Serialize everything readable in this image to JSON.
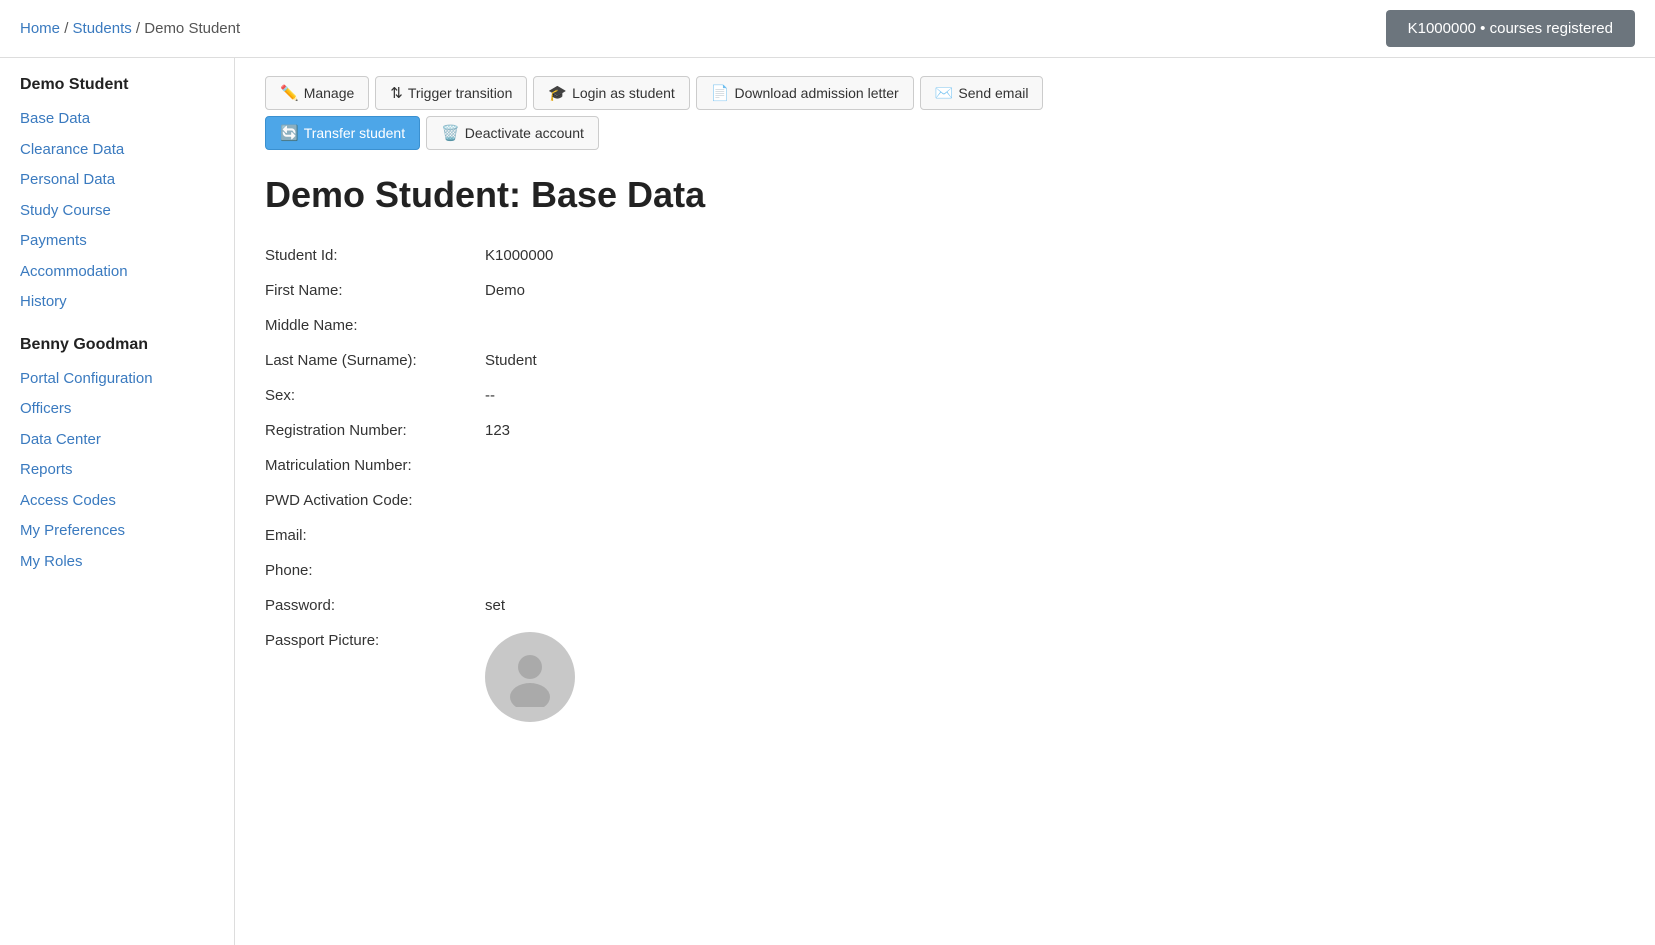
{
  "breadcrumb": {
    "home": "Home",
    "students": "Students",
    "current": "Demo Student",
    "separator": " / "
  },
  "top_badge": "K1000000 • courses registered",
  "buttons": {
    "manage": "Manage",
    "trigger_transition": "Trigger transition",
    "login_as_student": "Login as student",
    "download_admission_letter": "Download admission letter",
    "send_email": "Send email",
    "transfer_student": "Transfer student",
    "deactivate_account": "Deactivate account"
  },
  "page_title": "Demo Student: Base Data",
  "sidebar": {
    "section1_title": "Demo Student",
    "section1_links": [
      {
        "label": "Base Data",
        "name": "sidebar-base-data"
      },
      {
        "label": "Clearance Data",
        "name": "sidebar-clearance-data"
      },
      {
        "label": "Personal Data",
        "name": "sidebar-personal-data"
      },
      {
        "label": "Study Course",
        "name": "sidebar-study-course"
      },
      {
        "label": "Payments",
        "name": "sidebar-payments"
      },
      {
        "label": "Accommodation",
        "name": "sidebar-accommodation"
      },
      {
        "label": "History",
        "name": "sidebar-history"
      }
    ],
    "section2_title": "Benny Goodman",
    "section2_links": [
      {
        "label": "Portal Configuration",
        "name": "sidebar-portal-configuration"
      },
      {
        "label": "Officers",
        "name": "sidebar-officers"
      },
      {
        "label": "Data Center",
        "name": "sidebar-data-center"
      },
      {
        "label": "Reports",
        "name": "sidebar-reports"
      },
      {
        "label": "Access Codes",
        "name": "sidebar-access-codes"
      },
      {
        "label": "My Preferences",
        "name": "sidebar-my-preferences"
      },
      {
        "label": "My Roles",
        "name": "sidebar-my-roles"
      }
    ]
  },
  "fields": [
    {
      "label": "Student Id:",
      "value": "K1000000"
    },
    {
      "label": "First Name:",
      "value": "Demo"
    },
    {
      "label": "Middle Name:",
      "value": ""
    },
    {
      "label": "Last Name (Surname):",
      "value": "Student"
    },
    {
      "label": "Sex:",
      "value": "--"
    },
    {
      "label": "Registration Number:",
      "value": "123"
    },
    {
      "label": "Matriculation Number:",
      "value": ""
    },
    {
      "label": "PWD Activation Code:",
      "value": ""
    },
    {
      "label": "Email:",
      "value": ""
    },
    {
      "label": "Phone:",
      "value": ""
    },
    {
      "label": "Password:",
      "value": "set"
    },
    {
      "label": "Passport Picture:",
      "value": ""
    }
  ]
}
